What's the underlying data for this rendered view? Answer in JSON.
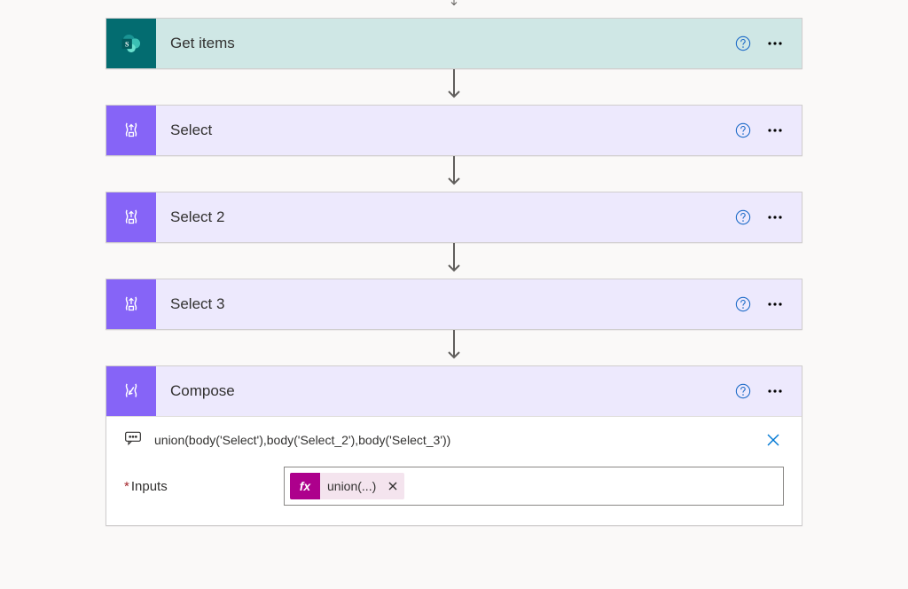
{
  "actions": {
    "getItems": {
      "title": "Get items"
    },
    "select": {
      "title": "Select"
    },
    "select2": {
      "title": "Select 2"
    },
    "select3": {
      "title": "Select 3"
    },
    "compose": {
      "title": "Compose"
    }
  },
  "composeBody": {
    "peekExpression": "union(body('Select'),body('Select_2'),body('Select_3'))",
    "inputsLabel": "Inputs",
    "token": {
      "fxLabel": "fx",
      "display": "union(...)"
    }
  }
}
